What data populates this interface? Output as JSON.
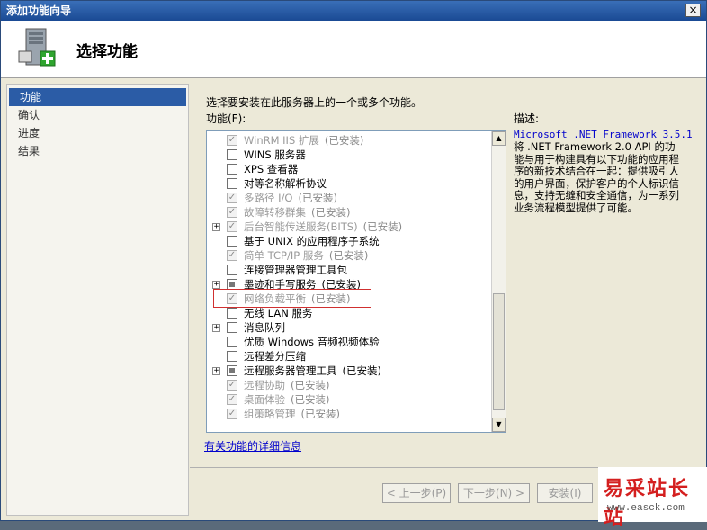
{
  "window": {
    "title": "添加功能向导",
    "close_label": "×"
  },
  "header": {
    "title": "选择功能",
    "icon": "server-add-icon"
  },
  "nav": {
    "items": [
      {
        "label": "功能",
        "active": true
      },
      {
        "label": "确认",
        "active": false
      },
      {
        "label": "进度",
        "active": false
      },
      {
        "label": "结果",
        "active": false
      }
    ]
  },
  "main": {
    "intro": "选择要安装在此服务器上的一个或多个功能。",
    "features_label": "功能(F):",
    "description_label": "描述:",
    "description_link": "Microsoft .NET Framework 3.5.1",
    "description_text": "将 .NET Framework 2.0 API 的功能与用于构建具有以下功能的应用程序的新技术结合在一起：提供吸引人的用户界面，保护客户的个人标识信息，支持无缝和安全通信，为一系列业务流程模型提供了可能。",
    "more_info_link": "有关功能的详细信息",
    "installed_text": "(已安装)"
  },
  "features": [
    {
      "label": "WinRM IIS 扩展",
      "state": "checked-disabled",
      "installed": true,
      "expander": false
    },
    {
      "label": "WINS 服务器",
      "state": "unchecked",
      "installed": false,
      "expander": false
    },
    {
      "label": "XPS 查看器",
      "state": "unchecked",
      "installed": false,
      "expander": false
    },
    {
      "label": "对等名称解析协议",
      "state": "unchecked",
      "installed": false,
      "expander": false
    },
    {
      "label": "多路径 I/O",
      "state": "checked-disabled",
      "installed": true,
      "expander": false
    },
    {
      "label": "故障转移群集",
      "state": "checked-disabled",
      "installed": true,
      "expander": false
    },
    {
      "label": "后台智能传送服务(BITS)",
      "state": "checked-disabled",
      "installed": true,
      "expander": true
    },
    {
      "label": "基于 UNIX 的应用程序子系统",
      "state": "unchecked",
      "installed": false,
      "expander": false
    },
    {
      "label": "简单 TCP/IP 服务",
      "state": "checked-disabled",
      "installed": true,
      "expander": false
    },
    {
      "label": "连接管理器管理工具包",
      "state": "unchecked",
      "installed": false,
      "expander": false
    },
    {
      "label": "墨迹和手写服务",
      "state": "partial",
      "installed": true,
      "expander": true
    },
    {
      "label": "网络负载平衡",
      "state": "checked-disabled",
      "installed": true,
      "expander": false
    },
    {
      "label": "无线 LAN 服务",
      "state": "unchecked",
      "installed": false,
      "expander": false
    },
    {
      "label": "消息队列",
      "state": "unchecked",
      "installed": false,
      "expander": true
    },
    {
      "label": "优质 Windows 音频视频体验",
      "state": "unchecked",
      "installed": false,
      "expander": false
    },
    {
      "label": "远程差分压缩",
      "state": "unchecked",
      "installed": false,
      "expander": false
    },
    {
      "label": "远程服务器管理工具",
      "state": "partial",
      "installed": true,
      "expander": true
    },
    {
      "label": "远程协助",
      "state": "checked-disabled",
      "installed": true,
      "expander": false
    },
    {
      "label": "桌面体验",
      "state": "checked-disabled",
      "installed": true,
      "expander": false
    },
    {
      "label": "组策略管理",
      "state": "checked-disabled",
      "installed": true,
      "expander": false
    }
  ],
  "buttons": {
    "prev": "< 上一步(P)",
    "next": "下一步(N) >",
    "install": "安装(I)"
  },
  "watermark": {
    "main": "易采站长站",
    "sub": "www.easck.com"
  },
  "colors": {
    "titlebar": "#1a4a94",
    "selection": "#2b5ca6",
    "link": "#0000cc",
    "highlight_border": "#d03030",
    "watermark_text": "#d41f1f"
  }
}
